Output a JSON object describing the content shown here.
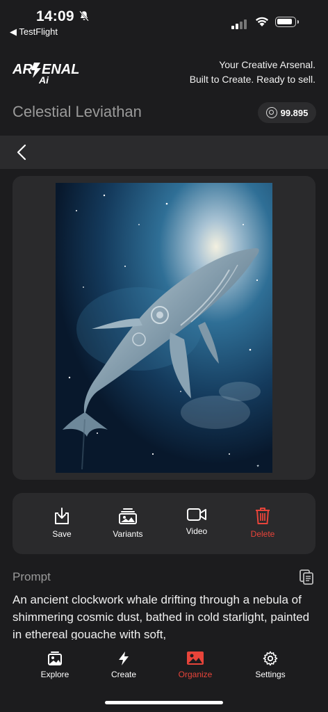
{
  "status_bar": {
    "time": "14:09",
    "back_app": "◀ TestFlight"
  },
  "header": {
    "logo_text": "ARSENAL Ai",
    "tagline_line1": "Your Creative Arsenal.",
    "tagline_line2": "Built to Create. Ready to sell.",
    "artwork_title": "Celestial Leviathan",
    "credits": "99.895"
  },
  "actions": [
    {
      "label": "Save",
      "icon": "download-icon"
    },
    {
      "label": "Variants",
      "icon": "images-icon"
    },
    {
      "label": "Video",
      "icon": "video-camera-icon"
    },
    {
      "label": "Delete",
      "icon": "trash-icon"
    }
  ],
  "prompt": {
    "heading": "Prompt",
    "text": "An ancient clockwork whale drifting through a nebula of shimmering cosmic dust, bathed in cold starlight, painted in ethereal gouache with soft,"
  },
  "tabs": [
    {
      "label": "Explore",
      "icon": "gallery-icon"
    },
    {
      "label": "Create",
      "icon": "lightning-icon"
    },
    {
      "label": "Organize",
      "icon": "image-icon",
      "active": true
    },
    {
      "label": "Settings",
      "icon": "gear-icon"
    }
  ],
  "colors": {
    "accent": "#e8443a",
    "background": "#1c1c1e",
    "card": "#2a2a2c"
  }
}
